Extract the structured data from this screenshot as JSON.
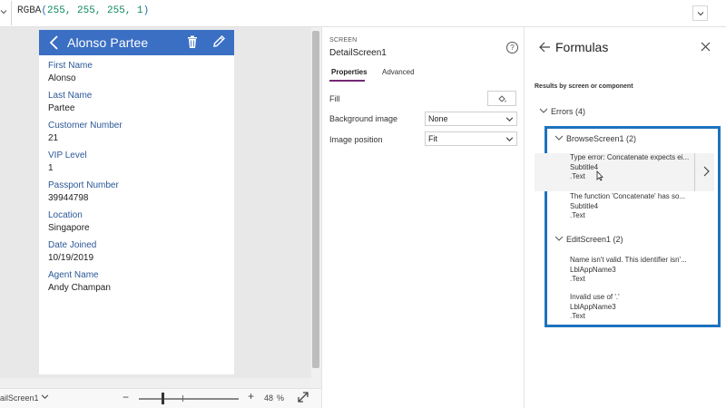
{
  "formula_bar": {
    "formula_prefix": "RGBA",
    "formula_open": "(",
    "formula_args": "255, 255, 255, 1",
    "formula_close": ")"
  },
  "app_preview": {
    "title": "Alonso Partee",
    "header_color": "#3b6fc4",
    "fields": [
      {
        "label": "First Name",
        "value": "Alonso"
      },
      {
        "label": "Last Name",
        "value": "Partee"
      },
      {
        "label": "Customer Number",
        "value": "21"
      },
      {
        "label": "VIP Level",
        "value": "1"
      },
      {
        "label": "Passport Number",
        "value": "39944798"
      },
      {
        "label": "Location",
        "value": "Singapore"
      },
      {
        "label": "Date Joined",
        "value": "10/19/2019"
      },
      {
        "label": "Agent Name",
        "value": "Andy Champan"
      }
    ]
  },
  "status_bar": {
    "screen_name": "ailScreen1",
    "zoom_value": "48",
    "zoom_unit": "%",
    "zoom_minus": "−",
    "zoom_plus": "+"
  },
  "properties_panel": {
    "kind": "SCREEN",
    "name": "DetailScreen1",
    "help": "?",
    "tabs": [
      "Properties",
      "Advanced"
    ],
    "active_tab": "Properties",
    "accent_color": "#742774",
    "props": {
      "fill_label": "Fill",
      "background_image_label": "Background image",
      "background_image_value": "None",
      "image_position_label": "Image position",
      "image_position_value": "Fit"
    }
  },
  "formulas_pane": {
    "title": "Formulas",
    "subtitle": "Results by screen or component",
    "errors_label": "Errors (4)",
    "highlight_color": "#1e73be",
    "groups": [
      {
        "name": "BrowseScreen1 (2)",
        "items": [
          {
            "message": "Type error: Concatenate expects ei...",
            "control": "Subtitle4",
            "property": ".Text"
          },
          {
            "message": "The function 'Concatenate' has so...",
            "control": "Subtitle4",
            "property": ".Text"
          }
        ]
      },
      {
        "name": "EditScreen1 (2)",
        "items": [
          {
            "message": "Name isn't valid. This identifier isn'...",
            "control": "LblAppName3",
            "property": ".Text"
          },
          {
            "message": "Invalid use of '.'",
            "control": "LblAppName3",
            "property": ".Text"
          }
        ]
      }
    ]
  }
}
